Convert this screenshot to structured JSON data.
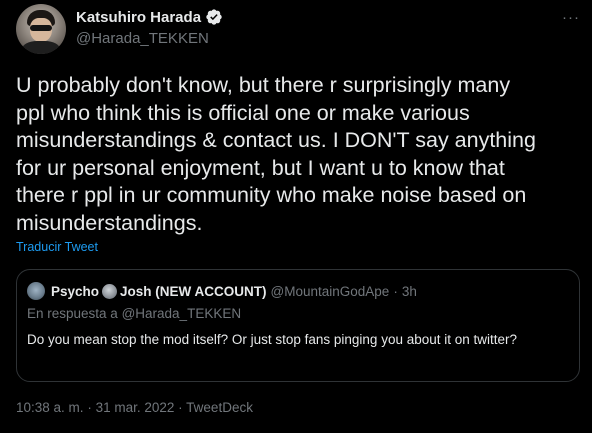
{
  "author": {
    "name": "Katsuhiro Harada",
    "handle": "@Harada_TEKKEN",
    "verified_icon": "verified-badge-icon"
  },
  "menu": {
    "more_label": "···"
  },
  "tweet": {
    "text": "U probably don't know, but there r surprisingly many\nppl who think this is official one or make various\nmisunderstandings & contact us. I DON'T say anything\nfor ur personal enjoyment, but I want u to know that\nthere r ppl in ur community who make noise based on\nmisunderstandings.",
    "translate_label": "Traducir Tweet"
  },
  "quoted": {
    "name_part1": "Psycho",
    "name_part2": "Josh (NEW ACCOUNT)",
    "handle": "@MountainGodApe",
    "separator": "·",
    "time": "3h",
    "reply_prefix": "En respuesta a",
    "reply_to": "@Harada_TEKKEN",
    "text": "Do you mean stop the mod itself? Or just stop fans pinging you about it on twitter?"
  },
  "footer": {
    "time": "10:38 a. m.",
    "separator1": "·",
    "date": "31 mar. 2022",
    "separator2": "·",
    "source": "TweetDeck"
  },
  "colors": {
    "background": "#000000",
    "primary_text": "#e7e9ea",
    "secondary_text": "#71767b",
    "link": "#1d9bf0",
    "verified": "#e7e9ea",
    "border": "#2f3336"
  }
}
